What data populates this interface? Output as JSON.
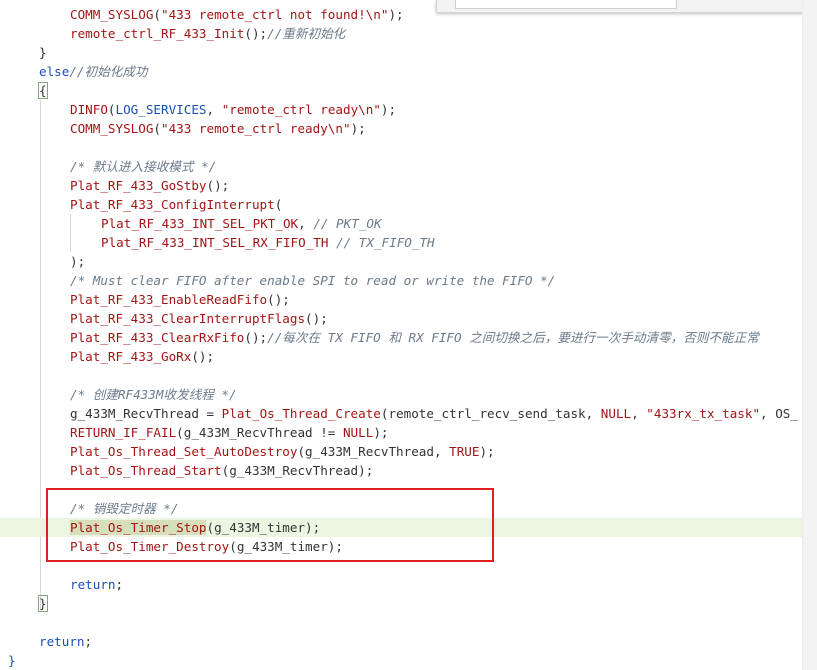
{
  "editor": {
    "lines": {
      "l01": {
        "a": "COMM_SYSLOG",
        "b": "(",
        "c": "\"433 remote_ctrl not found!\\n\"",
        "d": ");"
      },
      "l02": {
        "a": "remote_ctrl_RF_433_Init",
        "b": "();",
        "c": "//重新初始化"
      },
      "l03": {
        "a": "}"
      },
      "l04": {
        "a": "else",
        "b": "//初始化成功"
      },
      "l05": {
        "a": "{"
      },
      "l06": {
        "a": "DINFO",
        "b": "(",
        "c": "LOG_SERVICES",
        "d": ", ",
        "e": "\"remote_ctrl ready\\n\"",
        "f": ");"
      },
      "l07": {
        "a": "COMM_SYSLOG",
        "b": "(",
        "c": "\"433 remote_ctrl ready\\n\"",
        "d": ");"
      },
      "l08": {
        "a": "/* 默认进入接收模式 */"
      },
      "l09": {
        "a": "Plat_RF_433_GoStby",
        "b": "();"
      },
      "l10": {
        "a": "Plat_RF_433_ConfigInterrupt",
        "b": "("
      },
      "l11": {
        "a": "Plat_RF_433_INT_SEL_PKT_OK",
        "b": ", ",
        "c": "// PKT_OK"
      },
      "l12": {
        "a": "Plat_RF_433_INT_SEL_RX_FIFO_TH",
        "b": " ",
        "c": "// TX_FIFO_TH"
      },
      "l13": {
        "a": ");"
      },
      "l14": {
        "a": "/* Must clear FIFO after enable SPI to read or write the FIFO */"
      },
      "l15": {
        "a": "Plat_RF_433_EnableReadFifo",
        "b": "();"
      },
      "l16": {
        "a": "Plat_RF_433_ClearInterruptFlags",
        "b": "();"
      },
      "l17": {
        "a": "Plat_RF_433_ClearRxFifo",
        "b": "();",
        "c": "//每次在 TX FIFO 和 RX FIFO 之间切换之后，要进行一次手动清零，否则不能正常"
      },
      "l18": {
        "a": "Plat_RF_433_GoRx",
        "b": "();"
      },
      "l19": {
        "a": "/* 创建RF433M收发线程 */"
      },
      "l20": {
        "a": "g_433M_RecvThread",
        "b": " = ",
        "c": "Plat_Os_Thread_Create",
        "d": "(remote_ctrl_recv_send_task, ",
        "e": "NULL",
        "f": ", ",
        "g": "\"433rx_tx_task\"",
        "h": ", OS_"
      },
      "l21": {
        "a": "RETURN_IF_FAIL",
        "b": "(g_433M_RecvThread != ",
        "c": "NULL",
        "d": ");"
      },
      "l22": {
        "a": "Plat_Os_Thread_Set_AutoDestroy",
        "b": "(g_433M_RecvThread, ",
        "c": "TRUE",
        "d": ");"
      },
      "l23": {
        "a": "Plat_Os_Thread_Start",
        "b": "(g_433M_RecvThread);"
      },
      "l24": {
        "a": "/* 销毁定时器 */"
      },
      "l25": {
        "a": "Plat_Os_Timer_Stop",
        "b": "(g_433M_timer);"
      },
      "l26": {
        "a": "Plat_Os_Timer_Destroy",
        "b": "(g_433M_timer);"
      },
      "l27": {
        "a": "return",
        "b": ";"
      },
      "l28": {
        "a": "}"
      },
      "l29": {
        "a": "return",
        "b": ";"
      },
      "l30": {
        "a": "}"
      }
    }
  },
  "colors": {
    "keyword": "#1a4fb5",
    "function": "#a31515",
    "string": "#a31515",
    "comment": "#6b7a8a",
    "current_line": "#ecf5e1",
    "annotation_box": "#e02020"
  },
  "icons": {}
}
